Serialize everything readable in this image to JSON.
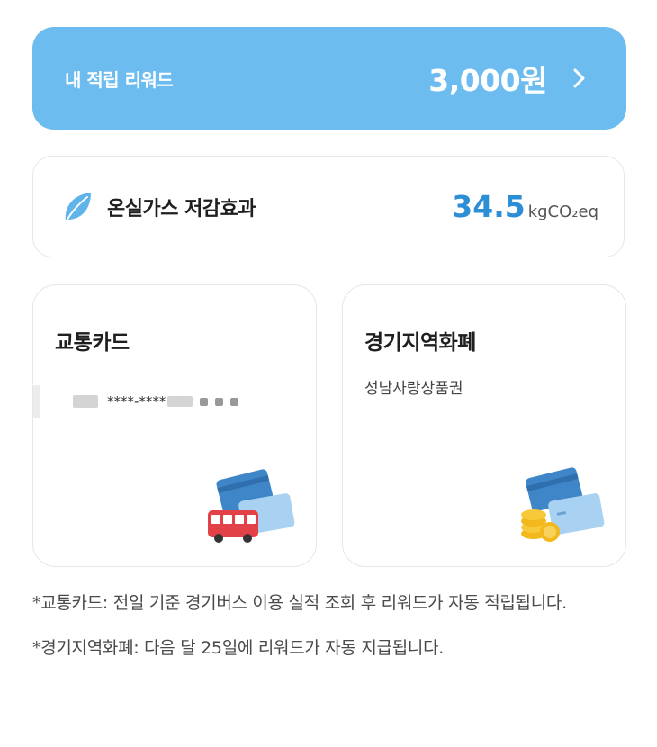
{
  "reward": {
    "label": "내 적립 리워드",
    "amount": "3,000원"
  },
  "ghg": {
    "label": "온실가스 저감효과",
    "value": "34.5",
    "unit": "kgCO₂eq"
  },
  "cards": {
    "transport": {
      "title": "교통카드",
      "masked_number": "****-****"
    },
    "currency": {
      "title": "경기지역화폐",
      "subtitle": "성남사랑상품권"
    }
  },
  "notes": {
    "transport": "*교통카드: 전일 기준 경기버스 이용 실적 조회 후 리워드가 자동 적립됩니다.",
    "currency": "*경기지역화폐: 다음 달 25일에 리워드가 자동 지급됩니다."
  },
  "colors": {
    "accent": "#6cbcef",
    "value_blue": "#2c8fd6",
    "leaf": "#5fb4ea"
  }
}
